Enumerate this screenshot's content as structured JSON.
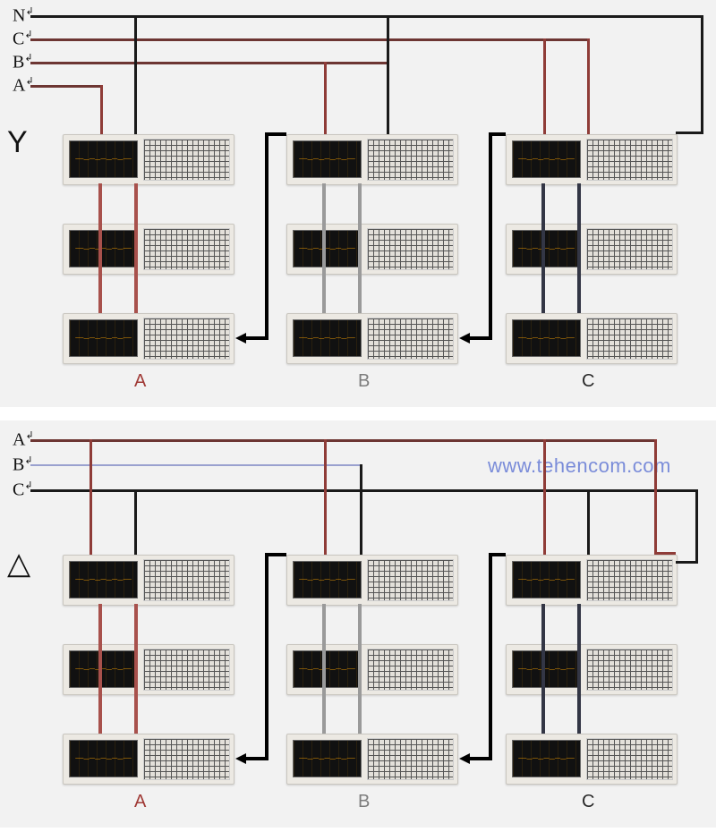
{
  "diagram": {
    "top": {
      "symbol": "Y",
      "bus": {
        "N": "N",
        "C": "C",
        "B": "B",
        "A": "A",
        "cr": "↲"
      },
      "columns": {
        "A": "A",
        "B": "B",
        "C": "C"
      }
    },
    "bottom": {
      "symbol": "△",
      "bus": {
        "A": "A",
        "B": "B",
        "C": "C",
        "cr": "↲"
      },
      "columns": {
        "A": "A",
        "B": "B",
        "C": "C"
      }
    },
    "watermark": "www.tehencom.com",
    "colors": {
      "N": "#1a1a1a",
      "A_line": "#8f3c38",
      "B_line_top": "#7d7d7d",
      "B_line_bottom": "#9aa1cf",
      "C_line": "#2a2a2a",
      "vert_A": "#a8514c",
      "vert_B": "#9a9a9a",
      "vert_C": "#333645"
    }
  }
}
